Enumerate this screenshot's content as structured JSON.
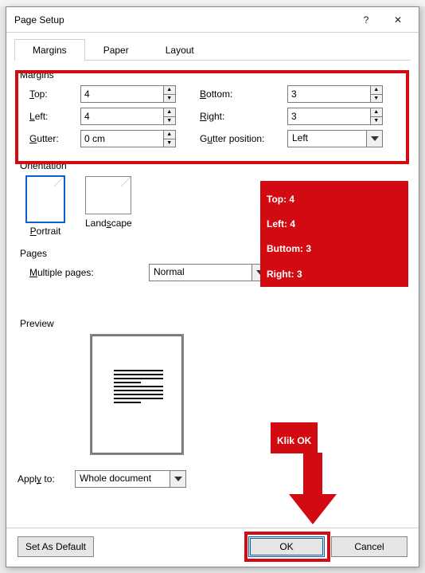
{
  "window": {
    "title": "Page Setup",
    "help_icon": "?",
    "close_icon": "✕"
  },
  "tabs": {
    "margins": "Margins",
    "paper": "Paper",
    "layout": "Layout",
    "active": "margins"
  },
  "margins_group": {
    "title": "Margins",
    "top_label": "Top:",
    "top_value": "4",
    "bottom_label": "Bottom:",
    "bottom_value": "3",
    "left_label": "Left:",
    "left_value": "4",
    "right_label": "Right:",
    "right_value": "3",
    "gutter_label": "Gutter:",
    "gutter_value": "0 cm",
    "gutter_pos_label": "Gutter position:",
    "gutter_pos_value": "Left"
  },
  "orientation": {
    "title": "Orientation",
    "portrait": "Portrait",
    "landscape": "Landscape",
    "selected": "portrait"
  },
  "pages": {
    "title": "Pages",
    "multiple_label": "Multiple pages:",
    "multiple_value": "Normal"
  },
  "preview": {
    "title": "Preview"
  },
  "apply": {
    "label": "Apply to:",
    "value": "Whole document"
  },
  "buttons": {
    "default": "Set As Default",
    "ok": "OK",
    "cancel": "Cancel"
  },
  "annotations": {
    "values_box": "Top: 4\nLeft: 4\nButtom: 3\nRight: 3",
    "click_ok": "Klik OK"
  }
}
